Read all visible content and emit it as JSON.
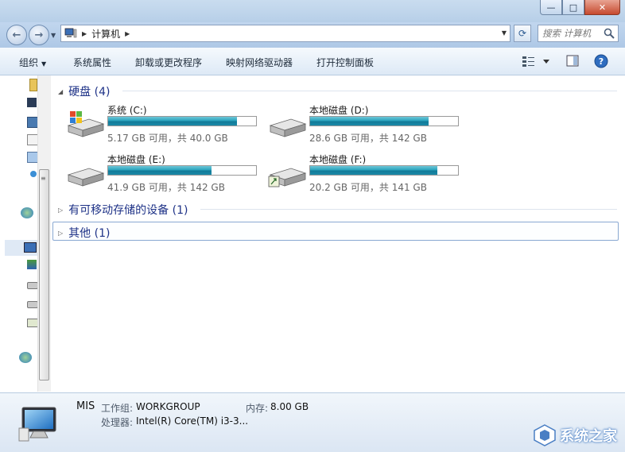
{
  "window": {
    "min_label": "—",
    "max_label": "□",
    "close_label": "✕"
  },
  "nav": {
    "back_icon": "back-arrow-icon",
    "forward_icon": "forward-arrow-icon",
    "address_crumb": "计算机",
    "search_placeholder": "搜索 计算机"
  },
  "toolbar": {
    "organize": "组织",
    "system_properties": "系统属性",
    "uninstall": "卸载或更改程序",
    "map_drive": "映射网络驱动器",
    "control_panel": "打开控制面板"
  },
  "groups": {
    "hard_disks": "硬盘 (4)",
    "removable": "有可移动存储的设备 (1)",
    "other": "其他 (1)"
  },
  "drives": [
    {
      "name": "系统 (C:)",
      "free_text": "5.17 GB 可用，共 40.0 GB",
      "used_fraction": 0.87
    },
    {
      "name": "本地磁盘 (D:)",
      "free_text": "28.6 GB 可用，共 142 GB",
      "used_fraction": 0.8
    },
    {
      "name": "本地磁盘 (E:)",
      "free_text": "41.9 GB 可用，共 142 GB",
      "used_fraction": 0.7
    },
    {
      "name": "本地磁盘 (F:)",
      "free_text": "20.2 GB 可用，共 141 GB",
      "used_fraction": 0.86
    }
  ],
  "details": {
    "computer_name": "MIS",
    "workgroup_label": "工作组:",
    "workgroup_value": "WORKGROUP",
    "memory_label": "内存:",
    "memory_value": "8.00 GB",
    "processor_label": "处理器:",
    "processor_value": "Intel(R) Core(TM) i3-3..."
  },
  "watermark": {
    "text": "系统之家"
  },
  "colors": {
    "accent": "#1e3287",
    "bar": "#2aa3bd"
  }
}
